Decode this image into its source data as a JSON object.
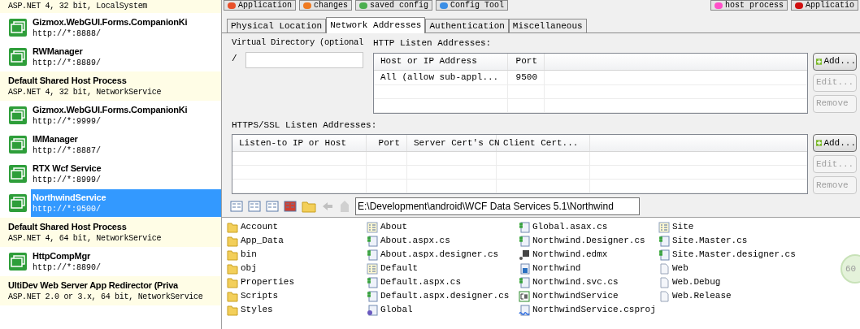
{
  "toolbar": {
    "buttons": [
      {
        "label": "Application",
        "color": "#e8502a"
      },
      {
        "label": "changes",
        "color": "#f07a20"
      },
      {
        "label": "saved config",
        "color": "#4caf50"
      },
      {
        "label": "Config Tool",
        "color": "#3a8ee6"
      }
    ],
    "right_buttons": [
      {
        "label": "host process",
        "color": "#ff4fc8"
      },
      {
        "label": "Applicatio",
        "color": "#d01010"
      }
    ]
  },
  "sidebar": {
    "items": [
      {
        "kind": "host",
        "subtitle": "ASP.NET 4, 32 bit, LocalSystem",
        "selected": false
      },
      {
        "kind": "app",
        "title": "Gizmox.WebGUI.Forms.CompanionKi",
        "subtitle": "http://*:8888/",
        "selected": false
      },
      {
        "kind": "app",
        "title": "RWManager",
        "subtitle": "http://*:8889/",
        "selected": false
      },
      {
        "kind": "host",
        "title": "Default Shared Host Process",
        "subtitle": "ASP.NET 4, 32 bit, NetworkService",
        "selected": false
      },
      {
        "kind": "app",
        "title": "Gizmox.WebGUI.Forms.CompanionKi",
        "subtitle": "http://*:9999/",
        "selected": false
      },
      {
        "kind": "app",
        "title": "IMManager",
        "subtitle": "http://*:8887/",
        "selected": false
      },
      {
        "kind": "app",
        "title": "RTX Wcf Service",
        "subtitle": "http://*:8999/",
        "selected": false
      },
      {
        "kind": "app",
        "title": "NorthwindService",
        "subtitle": "http://*:9500/",
        "selected": true
      },
      {
        "kind": "host",
        "title": "Default Shared Host Process",
        "subtitle": "ASP.NET 4, 64 bit, NetworkService",
        "selected": false
      },
      {
        "kind": "app",
        "title": "HttpCompMgr",
        "subtitle": "http://*:8890/",
        "selected": false
      },
      {
        "kind": "host",
        "title": "UltiDev Web Server App Redirector (Priva",
        "subtitle": "ASP.NET 2.0 or 3.x, 64 bit, NetworkService",
        "selected": false
      }
    ]
  },
  "tabs": [
    {
      "label": "Physical Location",
      "selected": false
    },
    {
      "label": "Network Addresses",
      "selected": true
    },
    {
      "label": "Authentication",
      "selected": false
    },
    {
      "label": "Miscellaneous",
      "selected": false
    }
  ],
  "virtual_directory": {
    "label": "Virtual Directory (optional",
    "prefix": "/"
  },
  "http": {
    "label": "HTTP Listen Addresses:",
    "columns": [
      "Host or IP Address",
      "Port"
    ],
    "rows": [
      [
        "All (allow sub-appl...",
        "9500"
      ]
    ]
  },
  "https": {
    "label": "HTTPS/SSL Listen Addresses:",
    "columns": [
      "Listen-to IP or Host",
      "Port",
      "Server Cert's CN",
      "Client Cert..."
    ]
  },
  "side_buttons": [
    {
      "label": "Add...",
      "disabled": false
    },
    {
      "label": "Edit...",
      "disabled": true
    },
    {
      "label": "Remove",
      "disabled": true
    }
  ],
  "side_buttons_2": [
    {
      "label": "Add...",
      "disabled": false
    },
    {
      "label": "Edit...",
      "disabled": true
    },
    {
      "label": "Remove",
      "disabled": true
    }
  ],
  "path": "E:\\Development\\android\\WCF Data Services 5.1\\Northwind",
  "files": [
    [
      {
        "name": "Account",
        "kind": "folder"
      },
      {
        "name": "App_Data",
        "kind": "folder"
      },
      {
        "name": "bin",
        "kind": "folder"
      },
      {
        "name": "obj",
        "kind": "folder"
      },
      {
        "name": "Properties",
        "kind": "folder"
      },
      {
        "name": "Scripts",
        "kind": "folder"
      },
      {
        "name": "Styles",
        "kind": "folder"
      }
    ],
    [
      {
        "name": "About",
        "kind": "form"
      },
      {
        "name": "About.aspx.cs",
        "kind": "cs"
      },
      {
        "name": "About.aspx.designer.cs",
        "kind": "cs"
      },
      {
        "name": "Default",
        "kind": "form"
      },
      {
        "name": "Default.aspx.cs",
        "kind": "cs"
      },
      {
        "name": "Default.aspx.designer.cs",
        "kind": "cs"
      },
      {
        "name": "Global",
        "kind": "gear"
      }
    ],
    [
      {
        "name": "Global.asax.cs",
        "kind": "cs"
      },
      {
        "name": "Northwind.Designer.cs",
        "kind": "cs"
      },
      {
        "name": "Northwind.edmx",
        "kind": "model"
      },
      {
        "name": "Northwind",
        "kind": "service"
      },
      {
        "name": "Northwind.svc.cs",
        "kind": "cs"
      },
      {
        "name": "NorthwindService",
        "kind": "project"
      },
      {
        "name": "NorthwindService.csproj",
        "kind": "csproj"
      }
    ],
    [
      {
        "name": "Site",
        "kind": "form"
      },
      {
        "name": "Site.Master.cs",
        "kind": "cs"
      },
      {
        "name": "Site.Master.designer.cs",
        "kind": "cs"
      },
      {
        "name": "Web",
        "kind": "doc"
      },
      {
        "name": "Web.Debug",
        "kind": "doc"
      },
      {
        "name": "Web.Release",
        "kind": "doc"
      }
    ]
  ],
  "badge": "60"
}
